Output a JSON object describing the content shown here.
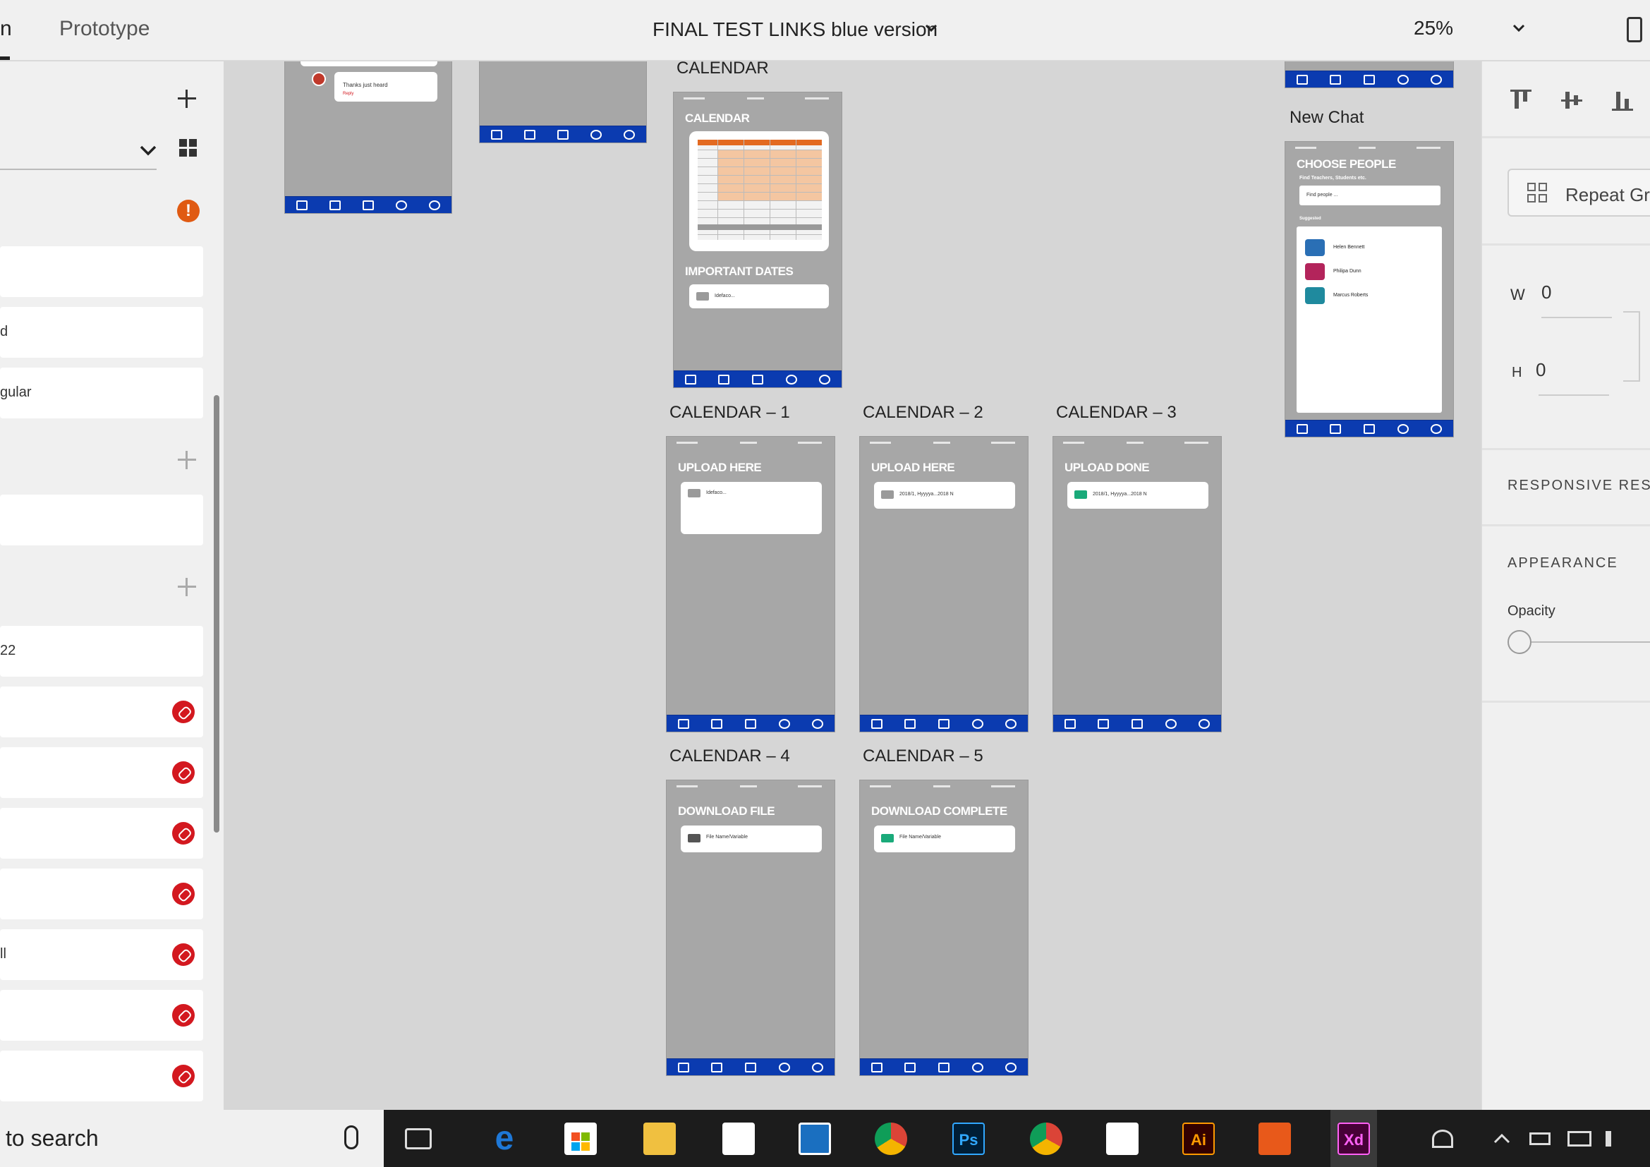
{
  "topbar": {
    "tab_design": "n",
    "tab_prototype": "Prototype",
    "document_title": "FINAL TEST LINKS blue version",
    "zoom": "25%"
  },
  "left_panel": {
    "fields": [
      "",
      "d",
      "gular",
      "",
      "22",
      "",
      "",
      "",
      "",
      "ll",
      ""
    ]
  },
  "canvas": {
    "artboards": {
      "calendar": {
        "label": "CALENDAR",
        "heading": "CALENDAR",
        "subheading": "IMPORTANT DATES",
        "card_text": "Idefaco..."
      },
      "calendar_1": {
        "label": "CALENDAR – 1",
        "heading": "UPLOAD HERE",
        "card_text": "Idefaco..."
      },
      "calendar_2": {
        "label": "CALENDAR – 2",
        "heading": "UPLOAD HERE",
        "card_text": "2018/1, Hyyyya...2018 N"
      },
      "calendar_3": {
        "label": "CALENDAR – 3",
        "heading": "UPLOAD DONE",
        "card_text": "2018/1, Hyyyya...2018 N"
      },
      "calendar_4": {
        "label": "CALENDAR – 4",
        "heading": "DOWNLOAD FILE",
        "card_text": "File Name/Variable"
      },
      "calendar_5": {
        "label": "CALENDAR – 5",
        "heading": "DOWNLOAD COMPLETE",
        "card_text": "File Name/Variable"
      },
      "new_chat": {
        "label": "New Chat",
        "heading": "CHOOSE PEOPLE",
        "subheading": "Find Teachers, Students etc.",
        "search_placeholder": "Find people ...",
        "suggested": "Suggested",
        "people": [
          "Helen Bennett",
          "Philipa Dunn",
          "Marcus Roberts"
        ]
      },
      "chat_thumb": {
        "text": "Thanks just heard",
        "sub": "Reply"
      }
    }
  },
  "right_panel": {
    "repeat_grid": "Repeat Gri",
    "w_label": "W",
    "w_value": "0",
    "h_label": "H",
    "h_value": "0",
    "responsive": "RESPONSIVE RES",
    "appearance": "APPEARANCE",
    "opacity": "Opacity"
  },
  "taskbar": {
    "search_text": "to search",
    "apps": [
      "task-view",
      "edge",
      "store",
      "file-explorer",
      "mail",
      "app",
      "chrome",
      "photoshop",
      "chrome",
      "photos",
      "illustrator",
      "video",
      "xd"
    ],
    "ps_label": "Ps",
    "ai_label": "Ai",
    "xd_label": "Xd"
  },
  "colors": {
    "nav_blue": "#0b3bb0",
    "link_red": "#d3181f",
    "warning_orange": "#e05a12",
    "artboard_gray": "#a7a7a7"
  }
}
